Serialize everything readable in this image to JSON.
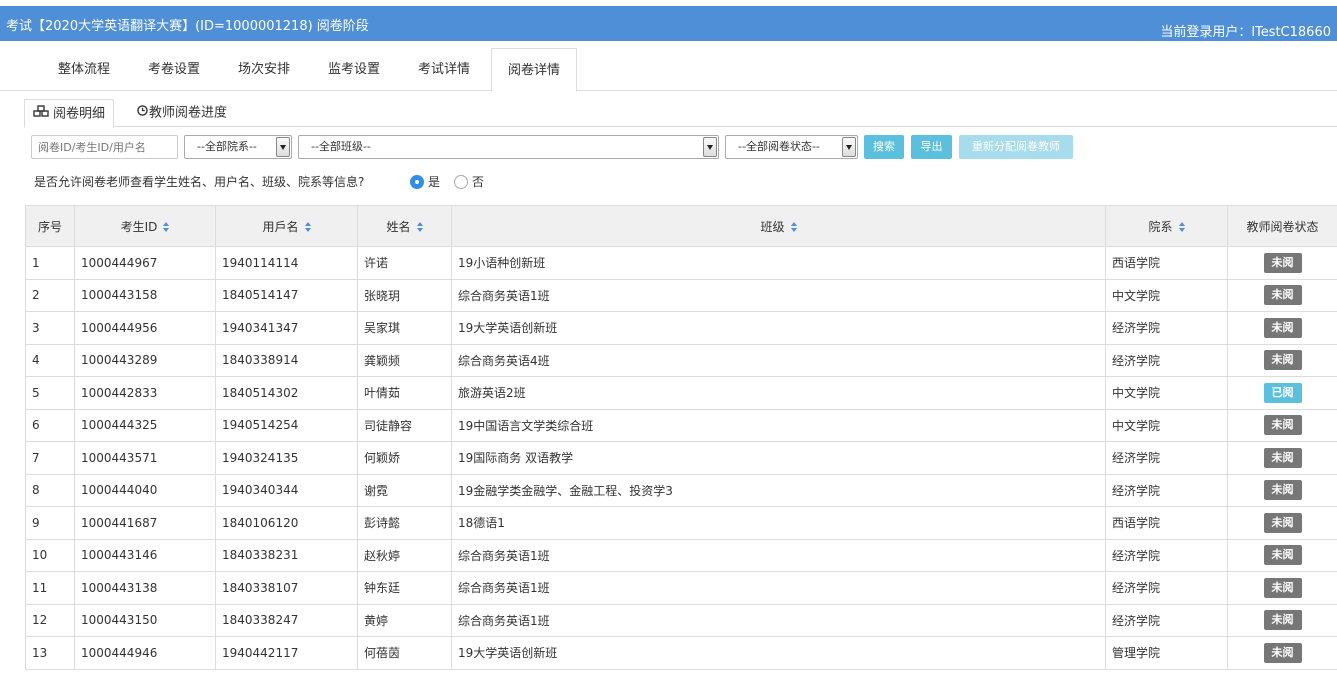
{
  "header": {
    "title": "考试【2020大学英语翻译大赛】(ID=1000001218) 阅卷阶段",
    "user": "当前登录用户：lTestC18660"
  },
  "tabs": [
    {
      "label": "整体流程"
    },
    {
      "label": "考卷设置"
    },
    {
      "label": "场次安排"
    },
    {
      "label": "监考设置"
    },
    {
      "label": "考试详情"
    },
    {
      "label": "阅卷详情"
    }
  ],
  "active_tab": 5,
  "subtabs": [
    {
      "label": "阅卷明细",
      "icon": "cubes-icon"
    },
    {
      "label": "教师阅卷进度",
      "icon": "clock-icon"
    }
  ],
  "filters": {
    "search_placeholder": "阅卷ID/考生ID/用户名",
    "department": "--全部院系--",
    "class": "--全部班级--",
    "status": "--全部阅卷状态--",
    "search_btn": "搜索",
    "export_btn": "导出",
    "reassign_btn": "重新分配阅卷教师"
  },
  "privacy": {
    "question": "是否允许阅卷老师查看学生姓名、用户名、班级、院系等信息?",
    "yes": "是",
    "no": "否",
    "selected": "yes"
  },
  "colors": {
    "header_bg": "#4f8fd8",
    "unread": "#777777",
    "read": "#5bc0de"
  },
  "table": {
    "columns": [
      "序号",
      "考生ID",
      "用戶名",
      "姓名",
      "班级",
      "院系",
      "教师阅卷状态"
    ],
    "rows": [
      [
        "1",
        "1000444967",
        "1940114114",
        "许诺",
        "19小语种创新班",
        "西语学院",
        "未阅"
      ],
      [
        "2",
        "1000443158",
        "1840514147",
        "张晓玥",
        "综合商务英语1班",
        "中文学院",
        "未阅"
      ],
      [
        "3",
        "1000444956",
        "1940341347",
        "吴家琪",
        "19大学英语创新班",
        "经济学院",
        "未阅"
      ],
      [
        "4",
        "1000443289",
        "1840338914",
        "龚颖频",
        "综合商务英语4班",
        "经济学院",
        "未阅"
      ],
      [
        "5",
        "1000442833",
        "1840514302",
        "叶倩茹",
        "旅游英语2班",
        "中文学院",
        "已阅"
      ],
      [
        "6",
        "1000444325",
        "1940514254",
        "司徒静容",
        "19中国语言文学类综合班",
        "中文学院",
        "未阅"
      ],
      [
        "7",
        "1000443571",
        "1940324135",
        "何颖娇",
        "19国际商务 双语教学",
        "经济学院",
        "未阅"
      ],
      [
        "8",
        "1000444040",
        "1940340344",
        "谢霓",
        "19金融学类金融学、金融工程、投资学3",
        "经济学院",
        "未阅"
      ],
      [
        "9",
        "1000441687",
        "1840106120",
        "彭诗懿",
        "18德语1",
        "西语学院",
        "未阅"
      ],
      [
        "10",
        "1000443146",
        "1840338231",
        "赵秋婷",
        "综合商务英语1班",
        "经济学院",
        "未阅"
      ],
      [
        "11",
        "1000443138",
        "1840338107",
        "钟东廷",
        "综合商务英语1班",
        "经济学院",
        "未阅"
      ],
      [
        "12",
        "1000443150",
        "1840338247",
        "黄婷",
        "综合商务英语1班",
        "经济学院",
        "未阅"
      ],
      [
        "13",
        "1000444946",
        "1940442117",
        "何蓓茵",
        "19大学英语创新班",
        "管理学院",
        "未阅"
      ]
    ]
  }
}
